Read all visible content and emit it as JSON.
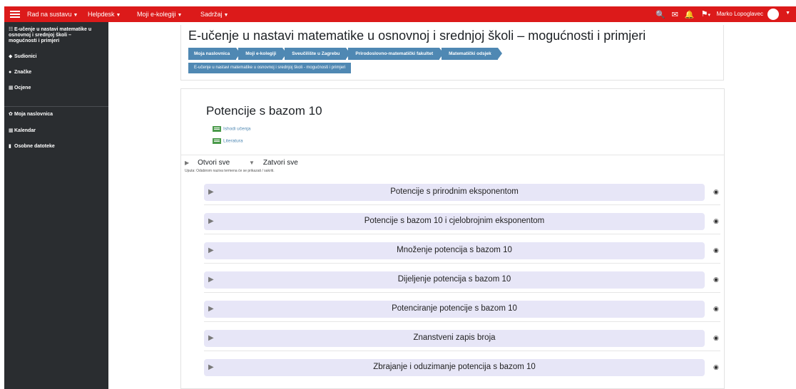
{
  "navbar": {
    "menus": [
      "Rad na sustavu",
      "Helpdesk",
      "Moji e-kolegiji",
      "Sadržaj"
    ],
    "user_name": "Marko Lopoglavec",
    "icons": [
      "search-icon",
      "mail-icon",
      "bell-icon",
      "flag-icon"
    ],
    "color": "#dc1a1a"
  },
  "sidebar": {
    "items": [
      {
        "icon": "☷",
        "label": "E-učenje u nastavi matematike u"
      },
      {
        "icon": "",
        "label": "osnovnoj i srednjoj školi –"
      },
      {
        "icon": "",
        "label": "mogućnosti i primjeri"
      },
      {
        "icon": "👥",
        "label": "Sudionici"
      },
      {
        "icon": "⬤",
        "label": "Značke"
      },
      {
        "icon": "▦",
        "label": "Ocjene"
      },
      {
        "icon": "⛭",
        "label": "Moja naslovnica"
      },
      {
        "icon": "▦",
        "label": "Kalendar"
      },
      {
        "icon": "▮",
        "label": "Osobne datoteke"
      }
    ]
  },
  "header": {
    "title": "E-učenje u nastavi matematike u osnovnoj i srednjoj školi – mogućnosti i primjeri",
    "breadcrumbs": [
      "Moja naslovnica",
      "Moji e-kolegiji",
      "Sveučilište u Zagrebu",
      "Prirodoslovno-matematički fakultet",
      "Matematički odsjek"
    ],
    "course_button": "E-učenje u nastavi matematike u osnovnoj i srednjoj školi - mogućnosti i primjeri",
    "accent": "#4f88b3"
  },
  "main": {
    "section_title": "Potencije s bazom 10",
    "resources": [
      "Ishodi učenja",
      "Literatura"
    ],
    "expand_all": "Otvori sve",
    "collapse_all": "Zatvori sve",
    "hint": "Uputa: Odabirom naziva termena će se prikazati / sakriti.",
    "topics": [
      "Potencije s prirodnim eksponentom",
      "Potencije s bazom 10 i cjelobrojnim eksponentom",
      "Množenje potencija s bazom 10",
      "Dijeljenje potencija s bazom 10",
      "Potenciranje potencije s bazom 10",
      "Znanstveni zapis broja",
      "Zbrajanje i oduzimanje potencija s bazom 10"
    ]
  }
}
